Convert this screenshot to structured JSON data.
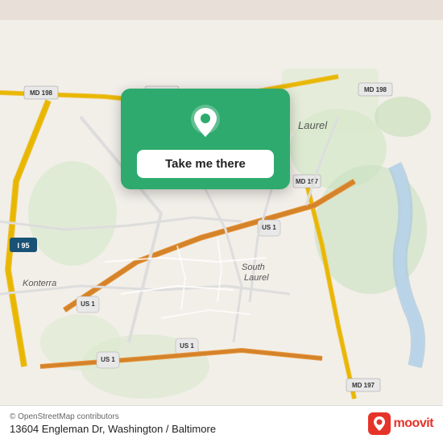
{
  "map": {
    "attribution": "© OpenStreetMap contributors",
    "address": "13604 Engleman Dr, Washington / Baltimore"
  },
  "popup": {
    "button_label": "Take me there"
  },
  "moovit": {
    "logo_text": "moovit"
  },
  "colors": {
    "popup_bg": "#2eaa6e",
    "moovit_red": "#e63329",
    "road_yellow": "#f5c518",
    "road_white": "#ffffff",
    "road_orange": "#e8943a",
    "water": "#b3d4e8",
    "park_green": "#c8e6c9",
    "map_bg": "#f2efe9"
  }
}
